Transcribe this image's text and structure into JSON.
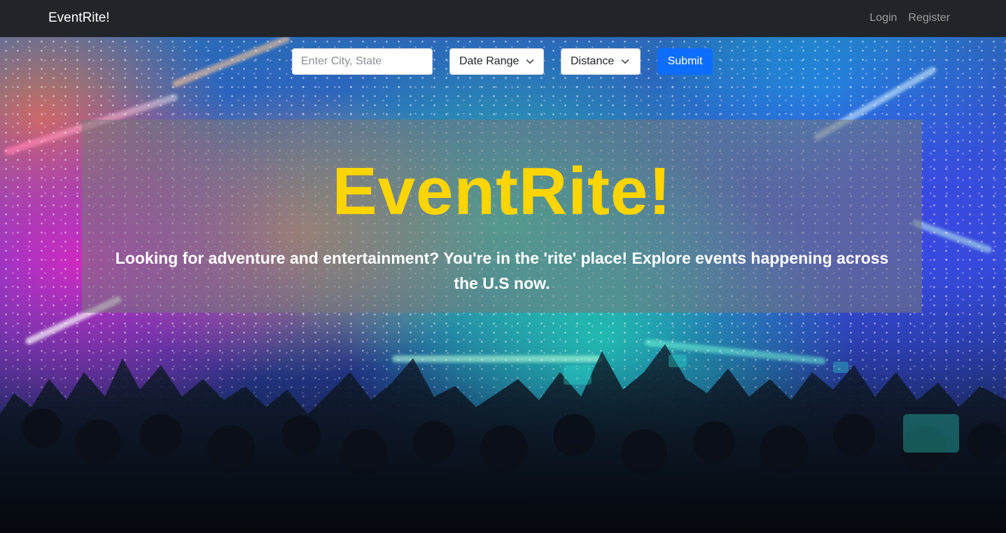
{
  "navbar": {
    "brand": "EventRite!",
    "links": [
      {
        "label": "Login"
      },
      {
        "label": "Register"
      }
    ],
    "background_color": "#212529"
  },
  "search": {
    "city_placeholder": "Enter City, State",
    "city_value": "",
    "date_range_label": "Date Range",
    "distance_label": "Distance",
    "submit_label": "Submit",
    "submit_color": "#0d6efd"
  },
  "hero": {
    "title": "EventRite!",
    "tagline": "Looking for adventure and entertainment? You're in the 'rite' place! Explore events happening across the U.S now.",
    "title_color": "#ffd500",
    "background_image": "concert crowd with colorful stage lights and confetti"
  }
}
